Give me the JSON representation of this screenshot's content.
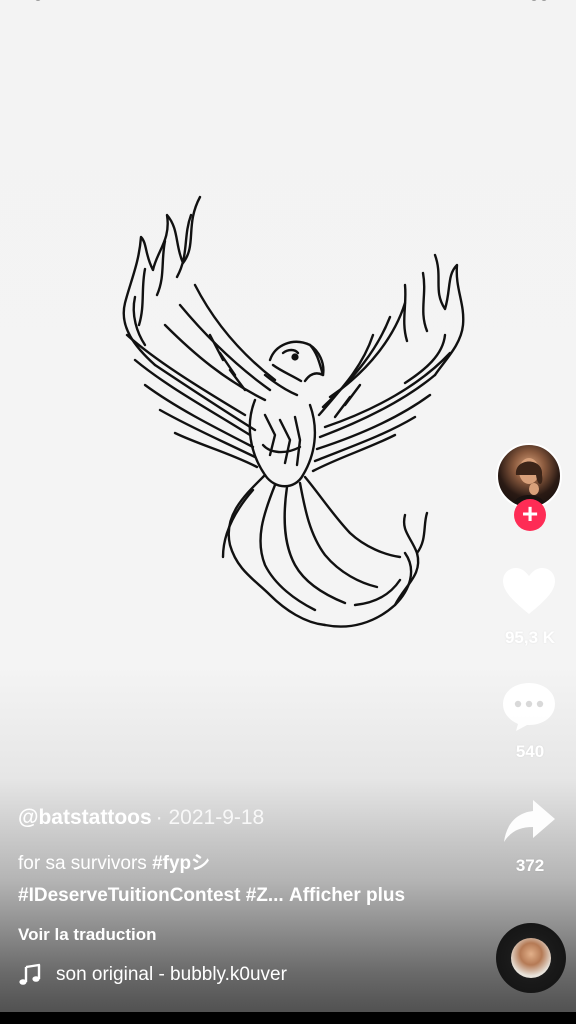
{
  "video": {
    "artwork_icon": "phoenix-tattoo-line-art"
  },
  "side_actions": {
    "follow_icon": "plus-icon",
    "like": {
      "icon": "heart-icon",
      "count": "95,3 K"
    },
    "comment": {
      "icon": "comment-bubble-icon",
      "count": "540"
    },
    "share": {
      "icon": "share-arrow-icon",
      "count": "372"
    },
    "music_disc_icon": "music-disc-avatar"
  },
  "caption": {
    "username": "@batstattoos",
    "date": "· 2021-9-18",
    "desc_text": "for sa survivors ",
    "desc_tag1": "#fypシ",
    "desc_tags_line2": "#IDeserveTuitionContest #Z...",
    "more_label": "Afficher plus",
    "translate_label": "Voir la traduction",
    "sound_icon": "music-note-icon",
    "sound_label": "son original - bubbly.k0uver"
  },
  "colors": {
    "follow_accent": "#fe2c55",
    "text": "#ffffff"
  }
}
